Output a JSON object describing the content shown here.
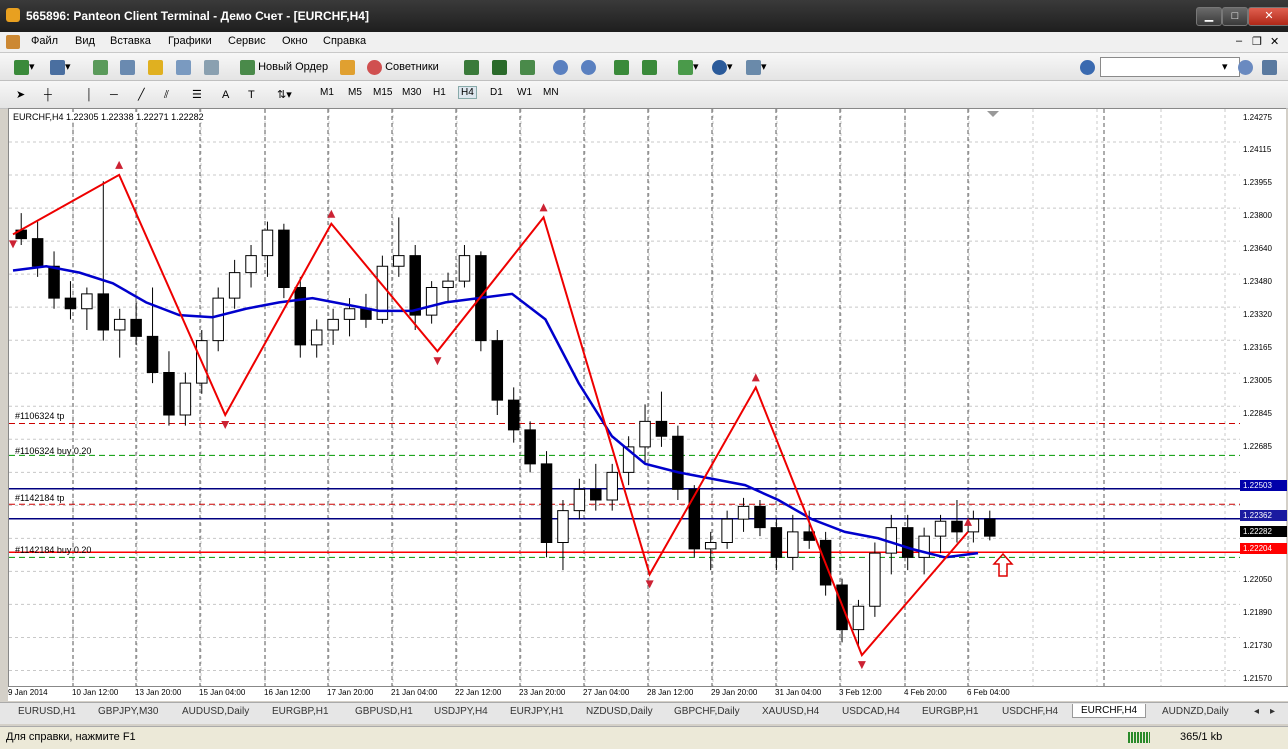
{
  "window": {
    "title": "565896: Panteon Client Terminal - Демо Счет - [EURCHF,H4]",
    "minimize": "▁",
    "maximize": "□",
    "close": "✕"
  },
  "menu": {
    "items": [
      "Файл",
      "Вид",
      "Вставка",
      "Графики",
      "Сервис",
      "Окно",
      "Справка"
    ],
    "doc_minimize": "–",
    "doc_restore": "❐",
    "doc_close": "✕"
  },
  "toolbar": {
    "new_order": "Новый Ордер",
    "advisors": "Советники",
    "search_placeholder": ""
  },
  "timeframes": [
    "M1",
    "M5",
    "M15",
    "M30",
    "H1",
    "H4",
    "D1",
    "W1",
    "MN"
  ],
  "active_timeframe": "H4",
  "chart": {
    "header": "EURCHF,H4  1.22305 1.22338 1.22271 1.22282",
    "price_labels": [
      "1.24275",
      "1.24115",
      "1.23955",
      "1.23800",
      "1.23640",
      "1.23480",
      "1.23320",
      "1.23165",
      "1.23005",
      "1.22845",
      "1.22685",
      "1.22503",
      "1.22362",
      "1.22282",
      "1.22204",
      "1.22050",
      "1.21890",
      "1.21730",
      "1.21570"
    ],
    "highlighted_prices": [
      {
        "value": "1.22503",
        "color": "#0000aa"
      },
      {
        "value": "1.22362",
        "color": "#1a1aa0"
      },
      {
        "value": "1.22282",
        "color": "#000000"
      },
      {
        "value": "1.22204",
        "color": "#ff0000"
      }
    ],
    "order_labels": [
      "#1106324 tp",
      "#1106324 buy 0.20",
      "#1142184 tp",
      "#1142184 buy 0.20"
    ],
    "time_labels": [
      "9 Jan 2014",
      "10 Jan 12:00",
      "13 Jan 20:00",
      "15 Jan 04:00",
      "16 Jan 12:00",
      "17 Jan 20:00",
      "21 Jan 04:00",
      "22 Jan 12:00",
      "23 Jan 20:00",
      "27 Jan 04:00",
      "28 Jan 12:00",
      "29 Jan 20:00",
      "31 Jan 04:00",
      "3 Feb 12:00",
      "4 Feb 20:00",
      "6 Feb 04:00"
    ]
  },
  "tabs": [
    "EURUSD,H1",
    "GBPJPY,M30",
    "AUDUSD,Daily",
    "EURGBP,H1",
    "GBPUSD,H1",
    "USDJPY,H4",
    "EURJPY,H1",
    "NZDUSD,Daily",
    "GBPCHF,Daily",
    "XAUUSD,H4",
    "USDCAD,H4",
    "EURGBP,H1",
    "USDCHF,H4",
    "EURCHF,H4",
    "AUDNZD,Daily"
  ],
  "active_tab": "EURCHF,H4",
  "status": {
    "help": "Для справки, нажмите F1",
    "traffic": "365/1 kb"
  },
  "chart_data": {
    "type": "candlestick",
    "symbol": "EURCHF",
    "timeframe": "H4",
    "ylim": [
      1.2157,
      1.2429
    ],
    "levels": [
      {
        "label": "#1106324 tp",
        "value": 1.2281,
        "color": "#cc0000",
        "style": "dashed"
      },
      {
        "label": "#1106324 buy 0.20",
        "value": 1.2266,
        "color": "#009900",
        "style": "dashed"
      },
      {
        "label": "#1142184 tp",
        "value": 1.2243,
        "color": "#cc0000",
        "style": "dashed"
      },
      {
        "label": "#1142184 buy 0.20",
        "value": 1.2218,
        "color": "#009900",
        "style": "dashed"
      },
      {
        "label": "",
        "value": 1.22503,
        "color": "#000080",
        "style": "solid"
      },
      {
        "label": "",
        "value": 1.22362,
        "color": "#000080",
        "style": "solid"
      },
      {
        "label": "",
        "value": 1.22204,
        "color": "#ff0000",
        "style": "solid"
      }
    ],
    "zigzag": [
      1.237,
      1.2398,
      1.2285,
      1.2375,
      1.2315,
      1.2378,
      1.221,
      1.2298,
      1.2172,
      1.223
    ],
    "ma": [
      1.2353,
      1.2355,
      1.2352,
      1.2347,
      1.2338,
      1.2332,
      1.2331,
      1.2335,
      1.2338,
      1.234,
      1.2337,
      1.2334,
      1.2334,
      1.2338,
      1.234,
      1.2342,
      1.233,
      1.23,
      1.2275,
      1.2262,
      1.2258,
      1.2255,
      1.2252,
      1.2245,
      1.2236,
      1.223,
      1.2227,
      1.2222,
      1.2218,
      1.222
    ],
    "candles": [
      {
        "o": 1.2372,
        "h": 1.238,
        "l": 1.2365,
        "c": 1.2368
      },
      {
        "o": 1.2368,
        "h": 1.2376,
        "l": 1.235,
        "c": 1.2355
      },
      {
        "o": 1.2355,
        "h": 1.2362,
        "l": 1.2335,
        "c": 1.234
      },
      {
        "o": 1.234,
        "h": 1.2348,
        "l": 1.233,
        "c": 1.2335
      },
      {
        "o": 1.2335,
        "h": 1.2345,
        "l": 1.2325,
        "c": 1.2342
      },
      {
        "o": 1.2342,
        "h": 1.2395,
        "l": 1.232,
        "c": 1.2325
      },
      {
        "o": 1.2325,
        "h": 1.2335,
        "l": 1.2312,
        "c": 1.233
      },
      {
        "o": 1.233,
        "h": 1.2338,
        "l": 1.2318,
        "c": 1.2322
      },
      {
        "o": 1.2322,
        "h": 1.2345,
        "l": 1.23,
        "c": 1.2305
      },
      {
        "o": 1.2305,
        "h": 1.2315,
        "l": 1.228,
        "c": 1.2285
      },
      {
        "o": 1.2285,
        "h": 1.2305,
        "l": 1.228,
        "c": 1.23
      },
      {
        "o": 1.23,
        "h": 1.2325,
        "l": 1.2295,
        "c": 1.232
      },
      {
        "o": 1.232,
        "h": 1.2345,
        "l": 1.2315,
        "c": 1.234
      },
      {
        "o": 1.234,
        "h": 1.2358,
        "l": 1.2335,
        "c": 1.2352
      },
      {
        "o": 1.2352,
        "h": 1.2365,
        "l": 1.2345,
        "c": 1.236
      },
      {
        "o": 1.236,
        "h": 1.2376,
        "l": 1.235,
        "c": 1.2372
      },
      {
        "o": 1.2372,
        "h": 1.2375,
        "l": 1.234,
        "c": 1.2345
      },
      {
        "o": 1.2345,
        "h": 1.235,
        "l": 1.2312,
        "c": 1.2318
      },
      {
        "o": 1.2318,
        "h": 1.233,
        "l": 1.2312,
        "c": 1.2325
      },
      {
        "o": 1.2325,
        "h": 1.2335,
        "l": 1.2318,
        "c": 1.233
      },
      {
        "o": 1.233,
        "h": 1.234,
        "l": 1.2322,
        "c": 1.2335
      },
      {
        "o": 1.2335,
        "h": 1.2342,
        "l": 1.2326,
        "c": 1.233
      },
      {
        "o": 1.233,
        "h": 1.236,
        "l": 1.2328,
        "c": 1.2355
      },
      {
        "o": 1.2355,
        "h": 1.2378,
        "l": 1.235,
        "c": 1.236
      },
      {
        "o": 1.236,
        "h": 1.2365,
        "l": 1.2325,
        "c": 1.2332
      },
      {
        "o": 1.2332,
        "h": 1.2348,
        "l": 1.2328,
        "c": 1.2345
      },
      {
        "o": 1.2345,
        "h": 1.2352,
        "l": 1.2338,
        "c": 1.2348
      },
      {
        "o": 1.2348,
        "h": 1.2365,
        "l": 1.2345,
        "c": 1.236
      },
      {
        "o": 1.236,
        "h": 1.2362,
        "l": 1.2315,
        "c": 1.232
      },
      {
        "o": 1.232,
        "h": 1.2325,
        "l": 1.2285,
        "c": 1.2292
      },
      {
        "o": 1.2292,
        "h": 1.2298,
        "l": 1.2272,
        "c": 1.2278
      },
      {
        "o": 1.2278,
        "h": 1.2282,
        "l": 1.2258,
        "c": 1.2262
      },
      {
        "o": 1.2262,
        "h": 1.2268,
        "l": 1.2218,
        "c": 1.2225
      },
      {
        "o": 1.2225,
        "h": 1.2245,
        "l": 1.2212,
        "c": 1.224
      },
      {
        "o": 1.224,
        "h": 1.2255,
        "l": 1.2236,
        "c": 1.225
      },
      {
        "o": 1.225,
        "h": 1.2262,
        "l": 1.224,
        "c": 1.2245
      },
      {
        "o": 1.2245,
        "h": 1.2262,
        "l": 1.224,
        "c": 1.2258
      },
      {
        "o": 1.2258,
        "h": 1.2275,
        "l": 1.2252,
        "c": 1.227
      },
      {
        "o": 1.227,
        "h": 1.229,
        "l": 1.2262,
        "c": 1.2282
      },
      {
        "o": 1.2282,
        "h": 1.2296,
        "l": 1.227,
        "c": 1.2275
      },
      {
        "o": 1.2275,
        "h": 1.228,
        "l": 1.2245,
        "c": 1.225
      },
      {
        "o": 1.225,
        "h": 1.2252,
        "l": 1.2218,
        "c": 1.2222
      },
      {
        "o": 1.2222,
        "h": 1.223,
        "l": 1.2212,
        "c": 1.2225
      },
      {
        "o": 1.2225,
        "h": 1.224,
        "l": 1.2222,
        "c": 1.2236
      },
      {
        "o": 1.2236,
        "h": 1.2246,
        "l": 1.223,
        "c": 1.2242
      },
      {
        "o": 1.2242,
        "h": 1.2245,
        "l": 1.2228,
        "c": 1.2232
      },
      {
        "o": 1.2232,
        "h": 1.2236,
        "l": 1.2212,
        "c": 1.2218
      },
      {
        "o": 1.2218,
        "h": 1.2238,
        "l": 1.2212,
        "c": 1.223
      },
      {
        "o": 1.223,
        "h": 1.224,
        "l": 1.2222,
        "c": 1.2226
      },
      {
        "o": 1.2226,
        "h": 1.223,
        "l": 1.22,
        "c": 1.2205
      },
      {
        "o": 1.2205,
        "h": 1.2208,
        "l": 1.2178,
        "c": 1.2184
      },
      {
        "o": 1.2184,
        "h": 1.2198,
        "l": 1.2176,
        "c": 1.2195
      },
      {
        "o": 1.2195,
        "h": 1.2225,
        "l": 1.219,
        "c": 1.222
      },
      {
        "o": 1.222,
        "h": 1.2238,
        "l": 1.221,
        "c": 1.2232
      },
      {
        "o": 1.2232,
        "h": 1.2238,
        "l": 1.2212,
        "c": 1.2218
      },
      {
        "o": 1.2218,
        "h": 1.2232,
        "l": 1.221,
        "c": 1.2228
      },
      {
        "o": 1.2228,
        "h": 1.2238,
        "l": 1.222,
        "c": 1.2235
      },
      {
        "o": 1.2235,
        "h": 1.2245,
        "l": 1.2225,
        "c": 1.223
      },
      {
        "o": 1.223,
        "h": 1.224,
        "l": 1.2225,
        "c": 1.2236
      },
      {
        "o": 1.2236,
        "h": 1.224,
        "l": 1.2226,
        "c": 1.2228
      }
    ]
  }
}
